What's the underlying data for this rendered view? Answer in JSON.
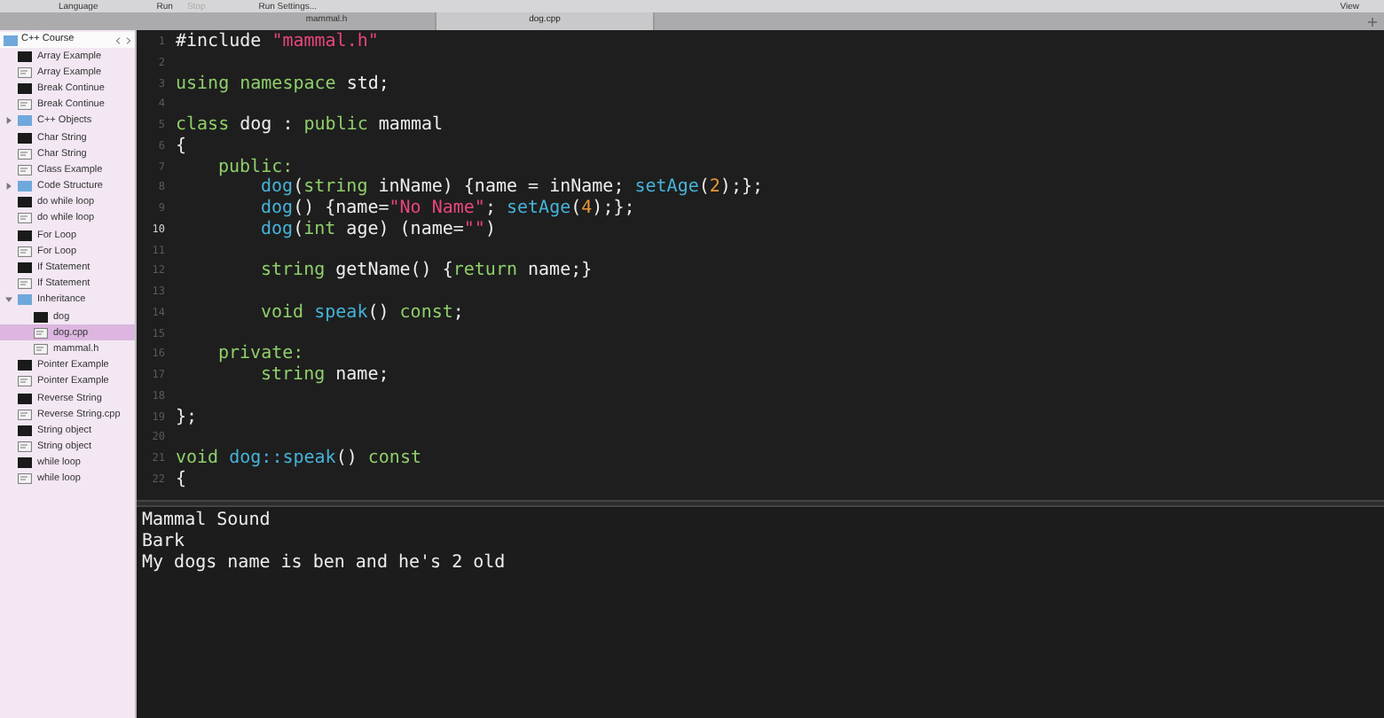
{
  "toolbar": [
    {
      "label": "Language",
      "disabled": false
    },
    {
      "label": "Run",
      "disabled": false
    },
    {
      "label": "Stop",
      "disabled": true
    },
    {
      "label": "Run Settings...",
      "disabled": false
    },
    {
      "label": "View",
      "disabled": false
    }
  ],
  "tabs": [
    {
      "label": "mammal.h",
      "selected": false
    },
    {
      "label": "dog.cpp",
      "selected": true
    }
  ],
  "sidebar": {
    "title": "C++ Course",
    "items": [
      {
        "kind": "exe",
        "label": "Array Example",
        "selected": false
      },
      {
        "kind": "source",
        "label": "Array Example",
        "selected": false
      },
      {
        "kind": "exe",
        "label": "Break Continue",
        "selected": false
      },
      {
        "kind": "source",
        "label": "Break Continue",
        "selected": false
      },
      {
        "kind": "folder",
        "label": "C++ Objects",
        "selected": false,
        "expanded": false
      },
      {
        "kind": "exe",
        "label": "Char String",
        "selected": false
      },
      {
        "kind": "source",
        "label": "Char String",
        "selected": false
      },
      {
        "kind": "source",
        "label": "Class Example",
        "selected": false
      },
      {
        "kind": "folder",
        "label": "Code Structure",
        "selected": false,
        "expanded": false
      },
      {
        "kind": "exe",
        "label": "do while loop",
        "selected": false
      },
      {
        "kind": "source",
        "label": "do while loop",
        "selected": false
      },
      {
        "kind": "exe",
        "label": "For Loop",
        "selected": false
      },
      {
        "kind": "source",
        "label": "For Loop",
        "selected": false
      },
      {
        "kind": "exe",
        "label": "If Statement",
        "selected": false
      },
      {
        "kind": "source",
        "label": "If Statement",
        "selected": false
      },
      {
        "kind": "folder",
        "label": "Inheritance",
        "selected": false,
        "expanded": true,
        "children": [
          {
            "kind": "exe",
            "label": "dog",
            "selected": false
          },
          {
            "kind": "source",
            "label": "dog.cpp",
            "selected": true
          },
          {
            "kind": "source",
            "label": "mammal.h",
            "selected": false
          }
        ]
      },
      {
        "kind": "exe",
        "label": "Pointer Example",
        "selected": false
      },
      {
        "kind": "source",
        "label": "Pointer Example",
        "selected": false
      },
      {
        "kind": "exe",
        "label": "Reverse String",
        "selected": false
      },
      {
        "kind": "source",
        "label": "Reverse String.cpp",
        "selected": false
      },
      {
        "kind": "exe",
        "label": "String object",
        "selected": false
      },
      {
        "kind": "source",
        "label": "String object",
        "selected": false
      },
      {
        "kind": "exe",
        "label": "while loop",
        "selected": false
      },
      {
        "kind": "source",
        "label": "while loop",
        "selected": false
      }
    ]
  },
  "editor": {
    "lines": [
      {
        "number": "1",
        "current": false,
        "kind": "top",
        "tokens": [
          {
            "kind": "plain",
            "text": "#include "
          },
          {
            "kind": "string",
            "text": "\"mammal.h\""
          }
        ]
      },
      {
        "number": "2",
        "current": false
      },
      {
        "number": "3",
        "current": false,
        "kind": "top",
        "tokens": [
          {
            "kind": "keyword",
            "text": "using namespace"
          },
          {
            "kind": "plain",
            "text": " std;"
          }
        ]
      },
      {
        "number": "4",
        "current": false
      },
      {
        "number": "5",
        "current": false,
        "kind": "top",
        "tokens": [
          {
            "kind": "keyword",
            "text": "class"
          },
          {
            "kind": "plain",
            "text": " dog : "
          },
          {
            "kind": "keyword",
            "text": "public"
          },
          {
            "kind": "plain",
            "text": " mammal"
          }
        ]
      },
      {
        "number": "6",
        "current": false,
        "kind": "top",
        "tokens": [
          {
            "kind": "plain",
            "text": "{"
          }
        ]
      },
      {
        "number": "7",
        "current": false,
        "kind": "access",
        "tokens": [
          {
            "kind": "keyword",
            "text": "public:"
          }
        ]
      },
      {
        "number": "8",
        "current": false,
        "kind": "member",
        "tokens": [
          {
            "kind": "func",
            "text": "dog"
          },
          {
            "kind": "plain",
            "text": "("
          },
          {
            "kind": "keyword",
            "text": "string"
          },
          {
            "kind": "plain",
            "text": " inName) {name = inName; "
          },
          {
            "kind": "func",
            "text": "setAge"
          },
          {
            "kind": "plain",
            "text": "("
          },
          {
            "kind": "number",
            "text": "2"
          },
          {
            "kind": "plain",
            "text": ");};"
          }
        ]
      },
      {
        "number": "9",
        "current": false,
        "kind": "member",
        "tokens": [
          {
            "kind": "func",
            "text": "dog"
          },
          {
            "kind": "plain",
            "text": "() {name="
          },
          {
            "kind": "string",
            "text": "\"No Name\""
          },
          {
            "kind": "plain",
            "text": "; "
          },
          {
            "kind": "func",
            "text": "setAge"
          },
          {
            "kind": "plain",
            "text": "("
          },
          {
            "kind": "number",
            "text": "4"
          },
          {
            "kind": "plain",
            "text": ");};"
          }
        ]
      },
      {
        "number": "10",
        "current": true,
        "kind": "member",
        "tokens": [
          {
            "kind": "func",
            "text": "dog"
          },
          {
            "kind": "plain",
            "text": "("
          },
          {
            "kind": "keyword",
            "text": "int"
          },
          {
            "kind": "plain",
            "text": " age) (name="
          },
          {
            "kind": "string",
            "text": "\"\""
          },
          {
            "kind": "plain",
            "text": ")"
          }
        ]
      },
      {
        "number": "11",
        "current": false
      },
      {
        "number": "12",
        "current": false,
        "kind": "member",
        "tokens": [
          {
            "kind": "keyword",
            "text": "string"
          },
          {
            "kind": "plain",
            "text": " getName() {"
          },
          {
            "kind": "keyword",
            "text": "return"
          },
          {
            "kind": "plain",
            "text": " name;}"
          }
        ]
      },
      {
        "number": "13",
        "current": false
      },
      {
        "number": "14",
        "current": false,
        "kind": "member",
        "tokens": [
          {
            "kind": "keyword",
            "text": "void "
          },
          {
            "kind": "func",
            "text": "speak"
          },
          {
            "kind": "plain",
            "text": "() "
          },
          {
            "kind": "keyword",
            "text": "const"
          },
          {
            "kind": "plain",
            "text": ";"
          }
        ]
      },
      {
        "number": "15",
        "current": false
      },
      {
        "number": "16",
        "current": false,
        "kind": "access",
        "tokens": [
          {
            "kind": "keyword",
            "text": "private:"
          }
        ]
      },
      {
        "number": "17",
        "current": false,
        "kind": "member",
        "tokens": [
          {
            "kind": "keyword",
            "text": "string"
          },
          {
            "kind": "plain",
            "text": " name;"
          }
        ]
      },
      {
        "number": "18",
        "current": false
      },
      {
        "number": "19",
        "current": false,
        "kind": "top",
        "tokens": [
          {
            "kind": "plain",
            "text": "};"
          }
        ]
      },
      {
        "number": "20",
        "current": false
      },
      {
        "number": "21",
        "current": false,
        "kind": "top",
        "tokens": [
          {
            "kind": "keyword",
            "text": "void "
          },
          {
            "kind": "func",
            "text": "dog::speak"
          },
          {
            "kind": "plain",
            "text": "() "
          },
          {
            "kind": "keyword",
            "text": "const"
          }
        ]
      },
      {
        "number": "22",
        "current": false,
        "kind": "top",
        "tokens": [
          {
            "kind": "plain",
            "text": "{"
          }
        ]
      }
    ]
  },
  "output": {
    "lines": [
      "Mammal Sound",
      "Bark",
      "My dogs name is ben and he's 2 old"
    ]
  }
}
